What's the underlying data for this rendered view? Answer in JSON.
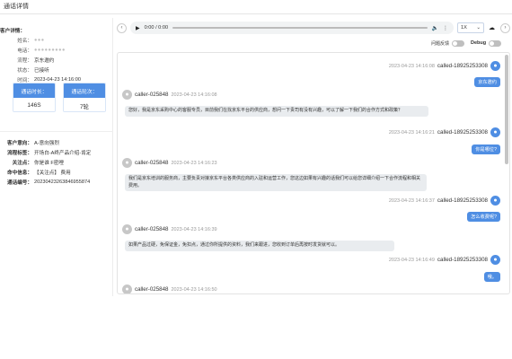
{
  "page": {
    "title": "通话详情"
  },
  "customer": {
    "section_label": "客户详情：",
    "fields": [
      {
        "label": "姓名：",
        "value": "",
        "blurred": true
      },
      {
        "label": "电话：",
        "value": "",
        "blurred": true
      },
      {
        "label": "流程：",
        "value": "京东邀约",
        "blurred": false
      },
      {
        "label": "状态：",
        "value": "已接听",
        "blurred": false
      },
      {
        "label": "时间：",
        "value": "2023-04-23 14:16:00",
        "blurred": false
      }
    ]
  },
  "stats": [
    {
      "label": "通话时长：",
      "value": "146S"
    },
    {
      "label": "通话轮次：",
      "value": "7轮"
    }
  ],
  "details": [
    {
      "label": "客户意向：",
      "value": "A-意向强烈",
      "link": true
    },
    {
      "label": "流程标签：",
      "value": "开场白-A终产品介绍-肯定",
      "link": true
    },
    {
      "label": "关注点：",
      "value": "你是谁 F密哩",
      "link": true
    },
    {
      "label": "命中信息：",
      "value": "【关注点】 费用",
      "link": true
    },
    {
      "label": "通话编号：",
      "value": "20230423263846955874",
      "link": true
    }
  ],
  "player": {
    "time": "0:00 / 0:00",
    "speed": "1X",
    "prev_icon": "chevron-left-icon",
    "next_icon": "chevron-right-icon"
  },
  "toggles": {
    "feedback_label": "问题反馈",
    "debug_label": "Debug"
  },
  "messages": [
    {
      "side": "right",
      "name": "called-18925253308",
      "time": "2023-04-23 14:16:08",
      "text": "京东邀约"
    },
    {
      "side": "left",
      "name": "caller-025848",
      "time": "2023-04-23 14:16:08",
      "text": "您好，我是京东采购中心的客服专员，目前我们在找京东平台的供应商，想问一下贵司有没有兴趣，可以了解一下我们的合作方式和政策？"
    },
    {
      "side": "right",
      "name": "called-18925253308",
      "time": "2023-04-23 14:16:21",
      "text": "你是哪位?"
    },
    {
      "side": "left",
      "name": "caller-025848",
      "time": "2023-04-23 14:16:23",
      "text": "我们是京东培训的服务商，主要负责对接京东平台各类供应商的入驻和运营工作，您这边如果有兴趣的话我们可以给您详细介绍一下合作流程和相关费用。"
    },
    {
      "side": "right",
      "name": "called-18925253308",
      "time": "2023-04-23 14:16:37",
      "text": "怎么收费呢?"
    },
    {
      "side": "left",
      "name": "caller-025848",
      "time": "2023-04-23 14:16:39",
      "text": "如果产品过硬，免保证金，免扣点，通过你所提供的资料，我们来跟进，您收到订单后再按时发货就可以。"
    },
    {
      "side": "right",
      "name": "called-18925253308",
      "time": "2023-04-23 14:16:49",
      "text": "哦。"
    },
    {
      "side": "left",
      "name": "caller-025848",
      "time": "2023-04-23 14:16:50",
      "text": ""
    }
  ]
}
